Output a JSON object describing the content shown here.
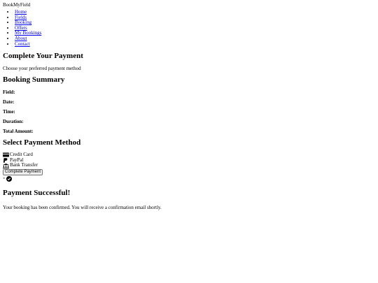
{
  "header": {
    "logo": "BookMyField"
  },
  "nav": {
    "items": [
      {
        "label": "Home"
      },
      {
        "label": "Fields"
      },
      {
        "label": "Booking"
      },
      {
        "label": "Offers"
      },
      {
        "label": "My Bookings"
      },
      {
        "label": "About"
      },
      {
        "label": "Contact"
      }
    ]
  },
  "main": {
    "title": "Complete Your Payment",
    "subtitle": "Choose your preferred payment method"
  },
  "summary": {
    "heading": "Booking Summary",
    "field_label": "Field:",
    "date_label": "Date:",
    "time_label": "Time:",
    "duration_label": "Duration:",
    "total_label": "Total Amount:"
  },
  "payment": {
    "heading": "Select Payment Method",
    "methods": [
      {
        "label": "Credit Card",
        "icon": "credit-card-icon"
      },
      {
        "label": "PayPal",
        "icon": "paypal-icon"
      },
      {
        "label": "Bank Transfer",
        "icon": "bank-icon"
      }
    ],
    "submit_label": "Complete Payment"
  },
  "modal": {
    "close_label": "×",
    "icon": "check-circle-icon",
    "title": "Payment Successful!",
    "message": "Your booking has been confirmed. You will receive a confirmation email shortly."
  }
}
